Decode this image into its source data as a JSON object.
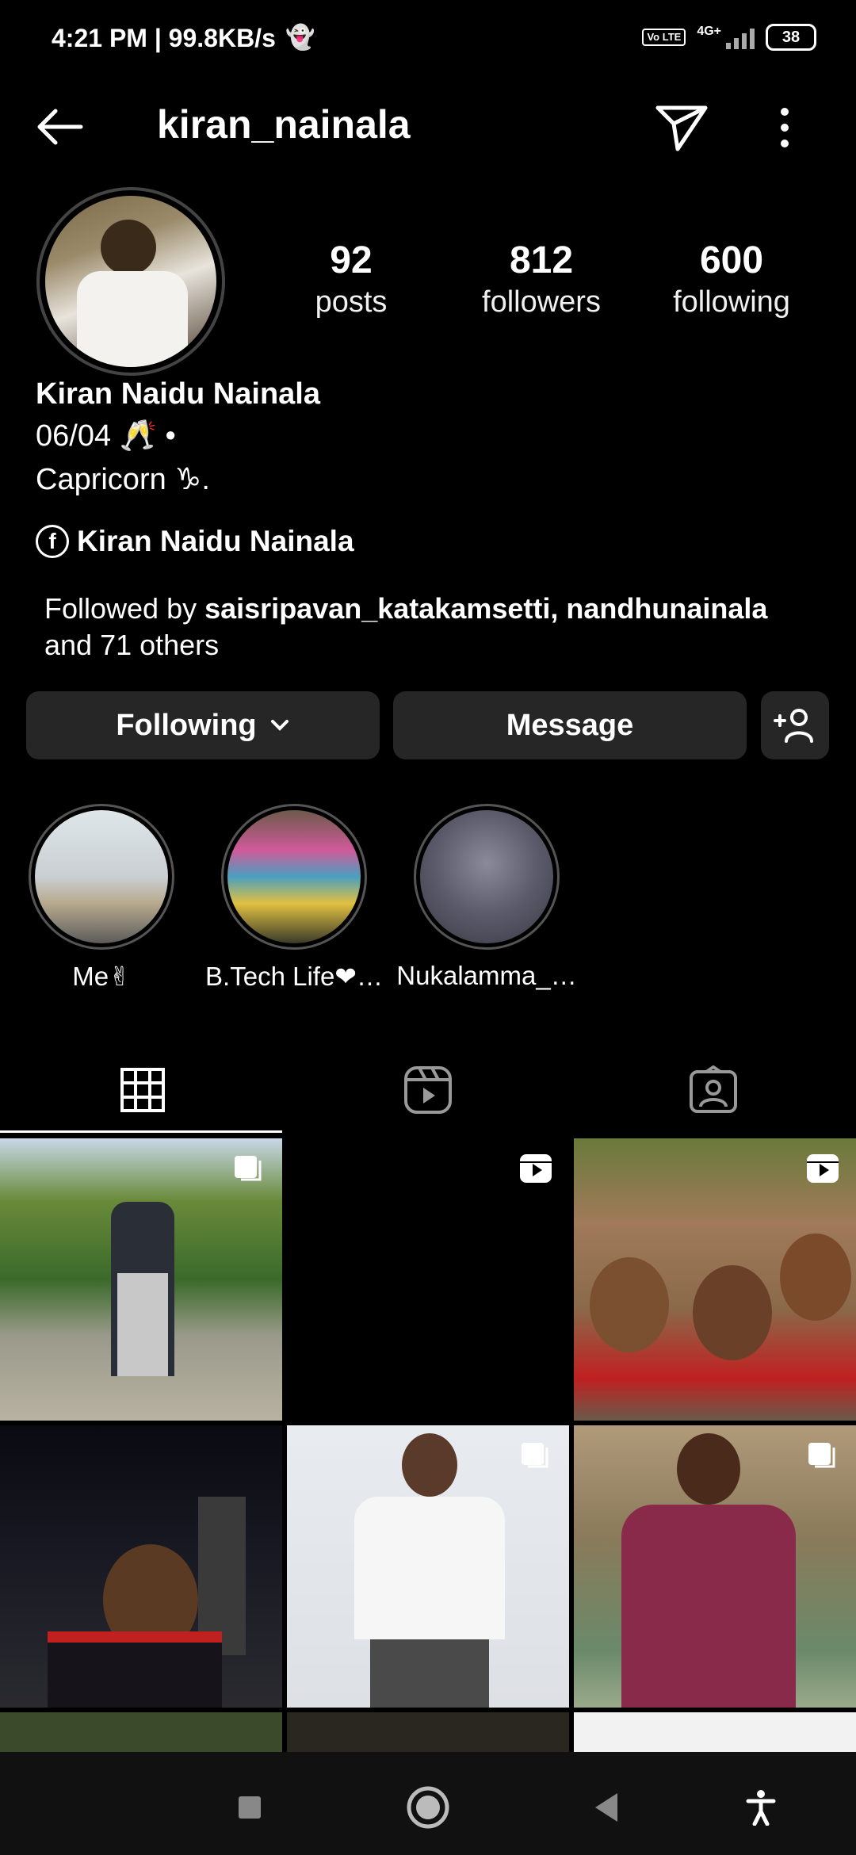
{
  "status_bar": {
    "time": "4:21 PM | 99.8KB/s",
    "network": "4G+",
    "volte": "Vo LTE",
    "battery": "38"
  },
  "header": {
    "username": "kiran_nainala"
  },
  "profile": {
    "stats": [
      {
        "value": "92",
        "label": "posts"
      },
      {
        "value": "812",
        "label": "followers"
      },
      {
        "value": "600",
        "label": "following"
      }
    ],
    "full_name": "Kiran Naidu Nainala",
    "bio_line1": "06/04 🥂 •",
    "bio_line2": "Capricorn ♑.",
    "facebook_name": "Kiran Naidu Nainala",
    "followed_by_prefix": "Followed by ",
    "followed_by_user1": "saisripavan_katakamsetti",
    "followed_by_sep": ", ",
    "followed_by_user2": "nandhunainala",
    "followed_by_suffix": " and 71 others"
  },
  "actions": {
    "following_label": "Following",
    "message_label": "Message"
  },
  "highlights": [
    {
      "label": "Me✌"
    },
    {
      "label": "B.Tech Life❤…"
    },
    {
      "label": "Nukalamma_…"
    }
  ],
  "tabs": [
    {
      "icon": "grid-icon"
    },
    {
      "icon": "reels-icon"
    },
    {
      "icon": "tagged-icon"
    }
  ],
  "colors": {
    "background": "#000000",
    "button_bg": "#262626",
    "text": "#ffffff"
  }
}
